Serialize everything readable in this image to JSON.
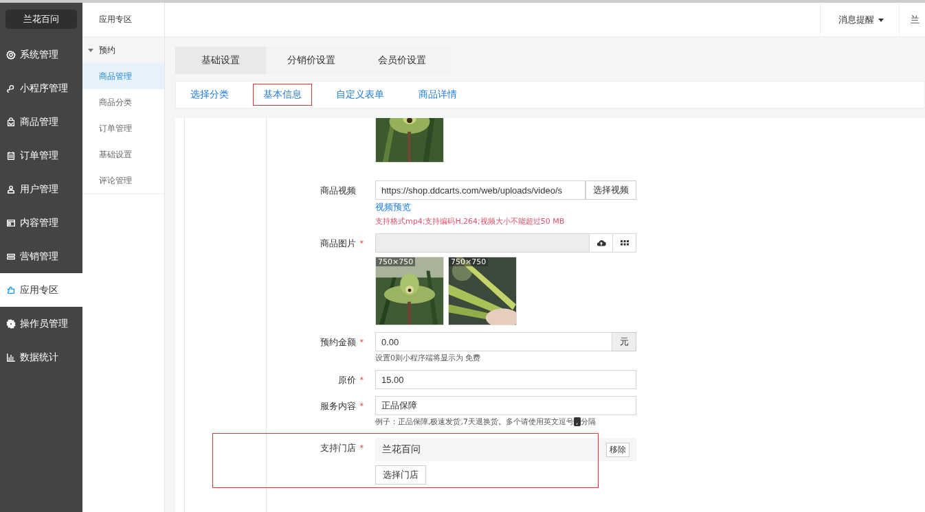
{
  "sidebar": {
    "logo": "兰花百问",
    "items": [
      {
        "label": "系统管理",
        "selected": false
      },
      {
        "label": "小程序管理",
        "selected": false
      },
      {
        "label": "商品管理",
        "selected": false
      },
      {
        "label": "订单管理",
        "selected": false
      },
      {
        "label": "用户管理",
        "selected": false
      },
      {
        "label": "内容管理",
        "selected": false
      },
      {
        "label": "营销管理",
        "selected": false
      },
      {
        "label": "应用专区",
        "selected": true
      },
      {
        "label": "操作员管理",
        "selected": false
      },
      {
        "label": "数据统计",
        "selected": false
      }
    ]
  },
  "submenu": {
    "title": "应用专区",
    "group": {
      "label": "预约",
      "expanded": true,
      "items": [
        {
          "label": "商品管理",
          "selected": true
        },
        {
          "label": "商品分类",
          "selected": false
        },
        {
          "label": "订单管理",
          "selected": false
        },
        {
          "label": "基础设置",
          "selected": false
        },
        {
          "label": "评论管理",
          "selected": false
        }
      ]
    }
  },
  "header": {
    "notice": "消息提醒",
    "user": "兰"
  },
  "tabs": [
    {
      "label": "基础设置",
      "selected": true
    },
    {
      "label": "分销价设置",
      "selected": false
    },
    {
      "label": "会员价设置",
      "selected": false
    }
  ],
  "subtabs": [
    {
      "label": "选择分类",
      "selected": false
    },
    {
      "label": "基本信息",
      "selected": true
    },
    {
      "label": "自定义表单",
      "selected": false
    },
    {
      "label": "商品详情",
      "selected": false
    }
  ],
  "form": [
    {
      "kind": "partial-image"
    },
    {
      "kind": "video",
      "label": "商品视频",
      "value": "https://shop.ddcarts.com/web/uploads/video/s",
      "button": "选择视频",
      "link": "视频预览",
      "note": "支持格式mp4;支持编码H.264;视频大小不能超过50 MB"
    },
    {
      "kind": "images",
      "label": "商品图片",
      "mark": "*",
      "images": [
        {
          "size": "750×750"
        },
        {
          "size": "750×750"
        }
      ]
    },
    {
      "kind": "addon",
      "label": "预约金额",
      "mark": "*",
      "value": "0.00",
      "addon": "元",
      "hint": "设置0则小程序端将显示为 免费"
    },
    {
      "kind": "text",
      "label": "原价",
      "mark": "*",
      "value": "15.00"
    },
    {
      "kind": "text",
      "label": "服务内容",
      "mark": "*",
      "value": "正品保障",
      "hint_parts": [
        "例子：正品保障,极速发货,7天退换货。多个请使用英文逗号",
        ",",
        "分隔"
      ]
    },
    {
      "kind": "stores",
      "label": "支持门店",
      "mark": "*",
      "highlighted": true,
      "stores": [
        {
          "name": "兰花百问",
          "action": "移除"
        }
      ],
      "button": "选择门店"
    }
  ]
}
